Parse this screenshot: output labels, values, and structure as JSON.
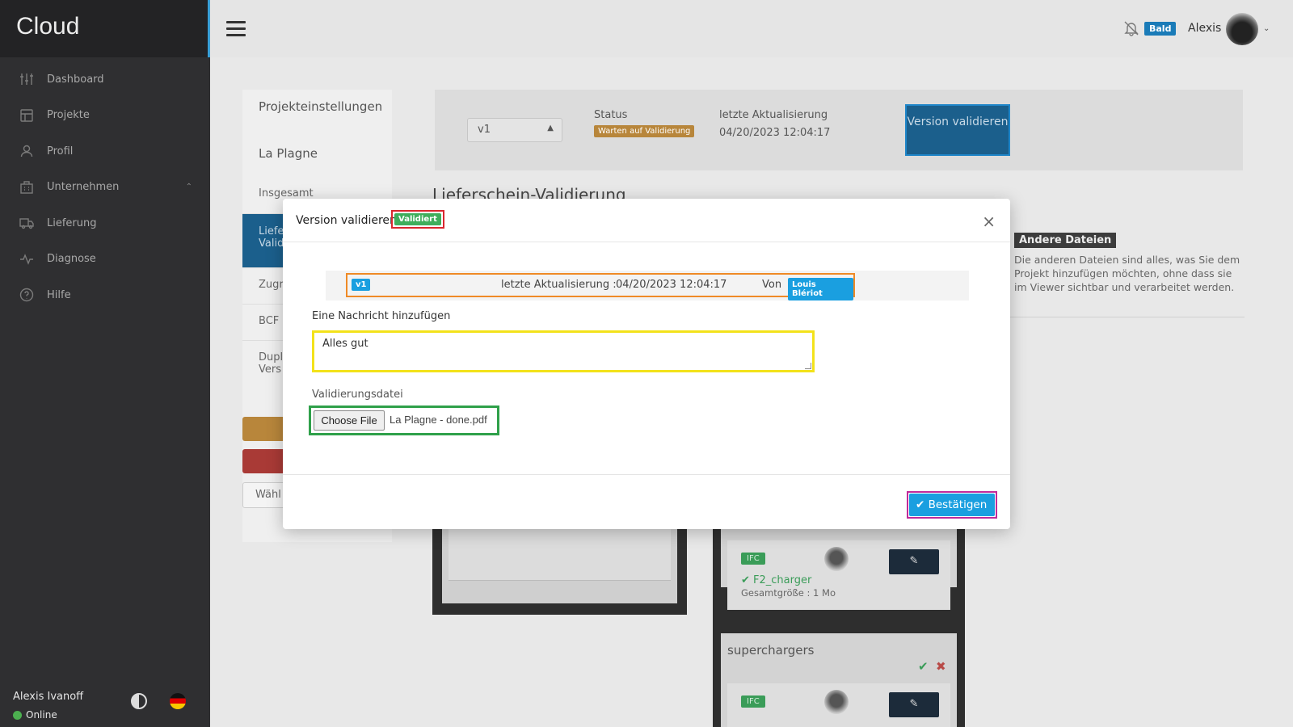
{
  "brand": "Cloud",
  "sidebar": {
    "items": [
      {
        "label": "Dashboard",
        "icon": "sliders-icon"
      },
      {
        "label": "Projekte",
        "icon": "layout-icon"
      },
      {
        "label": "Profil",
        "icon": "user-icon"
      },
      {
        "label": "Unternehmen",
        "icon": "building-icon"
      },
      {
        "label": "Lieferung",
        "icon": "truck-icon"
      },
      {
        "label": "Diagnose",
        "icon": "activity-icon"
      },
      {
        "label": "Hilfe",
        "icon": "help-icon"
      }
    ],
    "user_name": "Alexis Ivanoff",
    "status": "Online"
  },
  "topbar": {
    "badge": "Bald",
    "user": "Alexis"
  },
  "left_panel": {
    "title": "Projekteinstellungen",
    "project": "La Plagne",
    "items": [
      "Insgesamt",
      "Liefe Valid",
      "Zugr",
      "BCF",
      "Dupl Vers"
    ],
    "select_label": "Wähl"
  },
  "top_card": {
    "version": "v1",
    "status_label": "Status",
    "status_value": "Warten auf Validierung",
    "update_label": "letzte Aktualisierung",
    "update_value": "04/20/2023 12:04:17",
    "validate_button": "Version validieren"
  },
  "section_title": "Lieferschein-Validierung",
  "other_files": {
    "tag": "Andere Dateien",
    "text": "Die anderen Dateien sind alles, was Sie dem Projekt hinzufügen möchten, ohne dass sie im Viewer sichtbar und verarbeitet werden."
  },
  "cards": [
    {
      "tag": "IFC",
      "name": "F2_charger",
      "size": "Gesamtgröße : 1 Mo"
    },
    {
      "tag": "IFC"
    }
  ],
  "group_title": "superchargers",
  "modal": {
    "title": "Version validieren",
    "badge": "Validiert",
    "close": "×",
    "version": "v1",
    "update_label": "letzte Aktualisierung :",
    "update_value": "04/20/2023 12:04:17",
    "by_label": "Von",
    "by_user": "Louis Blériot",
    "message_label": "Eine Nachricht hinzufügen",
    "message_value": "Alles gut",
    "file_label": "Validierungsdatei",
    "choose_button": "Choose File",
    "file_name": "La Plagne - done.pdf",
    "confirm_button": "Bestätigen"
  }
}
